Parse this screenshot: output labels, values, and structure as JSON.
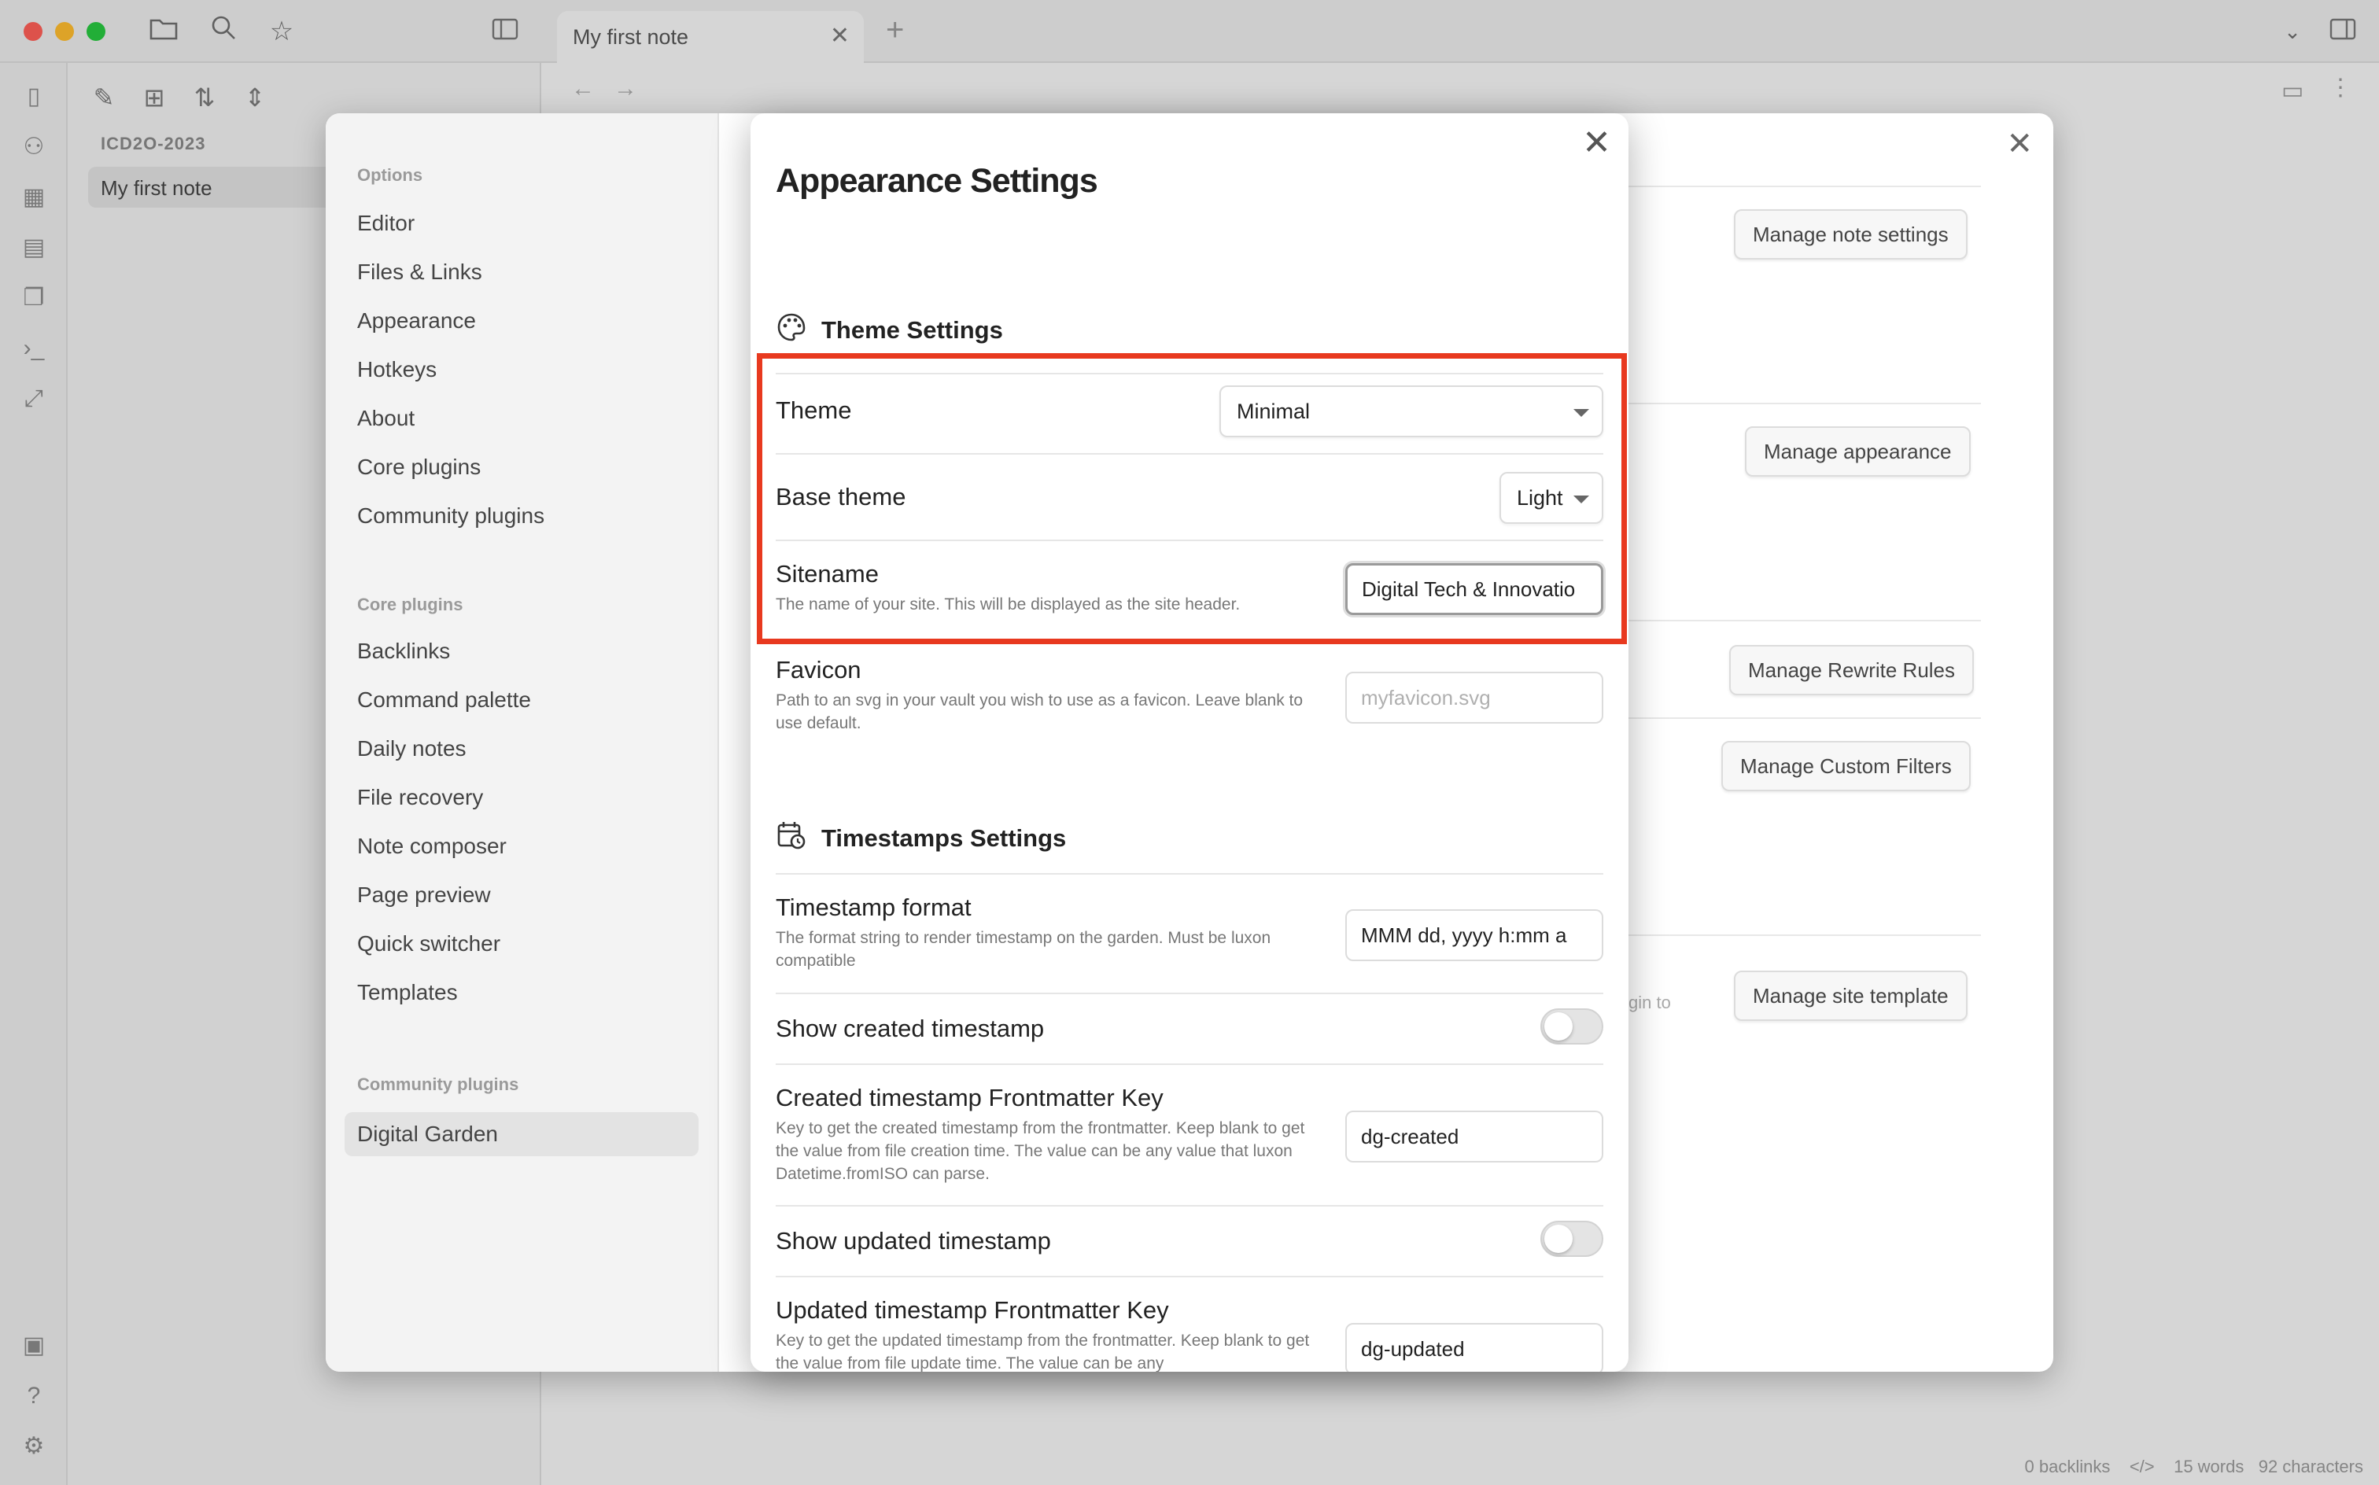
{
  "window": {
    "tab_title": "My first note",
    "tab_close": "✕",
    "tab_add": "+"
  },
  "file_explorer": {
    "vault_name": "ICD2O-2023",
    "files": [
      "My first note"
    ]
  },
  "status_bar": {
    "backlinks": "0 backlinks",
    "words": "15 words",
    "characters": "92 characters"
  },
  "settings": {
    "close": "✕",
    "sidebar": {
      "options_heading": "Options",
      "options": [
        "Editor",
        "Files & Links",
        "Appearance",
        "Hotkeys",
        "About",
        "Core plugins",
        "Community plugins"
      ],
      "core_heading": "Core plugins",
      "core": [
        "Backlinks",
        "Command palette",
        "Daily notes",
        "File recovery",
        "Note composer",
        "Page preview",
        "Quick switcher",
        "Templates"
      ],
      "community_heading": "Community plugins",
      "community": [
        "Digital Garden"
      ]
    },
    "buttons": {
      "note_settings": "Manage note settings",
      "appearance": "Manage appearance",
      "rewrite_rules": "Manage Rewrite Rules",
      "custom_filters": "Manage Custom Filters",
      "site_template": "Manage site template"
    },
    "partial_text": "gin to"
  },
  "modal": {
    "title": "Appearance Settings",
    "close": "✕",
    "theme_section": {
      "heading": "Theme Settings",
      "icon": "palette-icon",
      "theme": {
        "name": "Theme",
        "value": "Minimal"
      },
      "base_theme": {
        "name": "Base theme",
        "value": "Light"
      },
      "sitename": {
        "name": "Sitename",
        "desc": "The name of your site. This will be displayed as the site header.",
        "value": "Digital Tech & Innovatio"
      },
      "favicon": {
        "name": "Favicon",
        "desc": "Path to an svg in your vault you wish to use as a favicon. Leave blank to use default.",
        "placeholder": "myfavicon.svg"
      }
    },
    "timestamps_section": {
      "heading": "Timestamps Settings",
      "icon": "calendar-clock-icon",
      "format": {
        "name": "Timestamp format",
        "desc": "The format string to render timestamp on the garden. Must be luxon compatible",
        "value": "MMM dd, yyyy h:mm a"
      },
      "show_created": {
        "name": "Show created timestamp",
        "enabled": false
      },
      "created_key": {
        "name": "Created timestamp Frontmatter Key",
        "desc": "Key to get the created timestamp from the frontmatter. Keep blank to get the value from file creation time. The value can be any value that luxon Datetime.fromISO can parse.",
        "value": "dg-created"
      },
      "show_updated": {
        "name": "Show updated timestamp",
        "enabled": false
      },
      "updated_key": {
        "name": "Updated timestamp Frontmatter Key",
        "desc": "Key to get the updated timestamp from the frontmatter. Keep blank to get the value from file update time. The value can be any",
        "value": "dg-updated"
      }
    }
  },
  "colors": {
    "highlight": "#e8391f",
    "traffic_red": "#fe5f57",
    "traffic_yellow": "#febc2e",
    "traffic_green": "#28c840"
  }
}
